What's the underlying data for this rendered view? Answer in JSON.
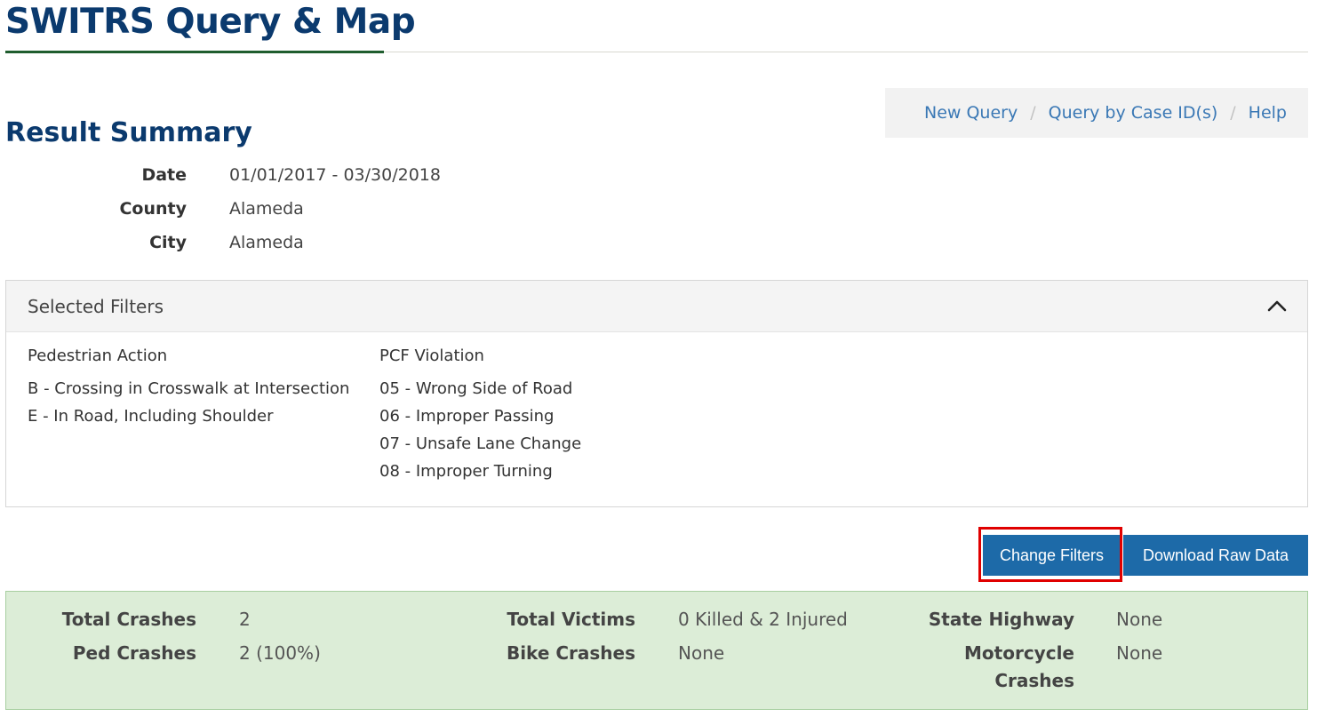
{
  "header": {
    "app_title": "SWITRS Query & Map"
  },
  "breadcrumb": {
    "items": [
      "New Query",
      "Query by Case ID(s)",
      "Help"
    ],
    "separator": "/"
  },
  "summary": {
    "title": "Result Summary",
    "rows": [
      {
        "label": "Date",
        "value": "01/01/2017 - 03/30/2018"
      },
      {
        "label": "County",
        "value": "Alameda"
      },
      {
        "label": "City",
        "value": "Alameda"
      }
    ]
  },
  "filters": {
    "title": "Selected Filters",
    "toggle_icon": "chevron-up-icon",
    "groups": [
      {
        "heading": "Pedestrian Action",
        "items": [
          "B - Crossing in Crosswalk at Intersection",
          "E - In Road, Including Shoulder"
        ]
      },
      {
        "heading": "PCF Violation",
        "items": [
          "05 - Wrong Side of Road",
          "06 - Improper Passing",
          "07 - Unsafe Lane Change",
          "08 - Improper Turning"
        ]
      }
    ]
  },
  "actions": {
    "change_filters": "Change Filters",
    "download_raw_data": "Download Raw Data"
  },
  "stats": {
    "total_crashes_label": "Total Crashes",
    "total_crashes_value": "2",
    "ped_crashes_label": "Ped Crashes",
    "ped_crashes_value": "2 (100%)",
    "total_victims_label": "Total Victims",
    "total_victims_value": "0 Killed & 2 Injured",
    "bike_crashes_label": "Bike Crashes",
    "bike_crashes_value": "None",
    "state_highway_label": "State Highway",
    "state_highway_value": "None",
    "motorcycle_label_line1": "Motorcycle",
    "motorcycle_label_line2": "Crashes",
    "motorcycle_value": "None"
  },
  "colors": {
    "title_navy": "#0b3a6e",
    "link_blue": "#3a78b5",
    "button_blue": "#1d6aa8",
    "stats_green": "#dcedd7",
    "highlight_red": "#e00000"
  }
}
